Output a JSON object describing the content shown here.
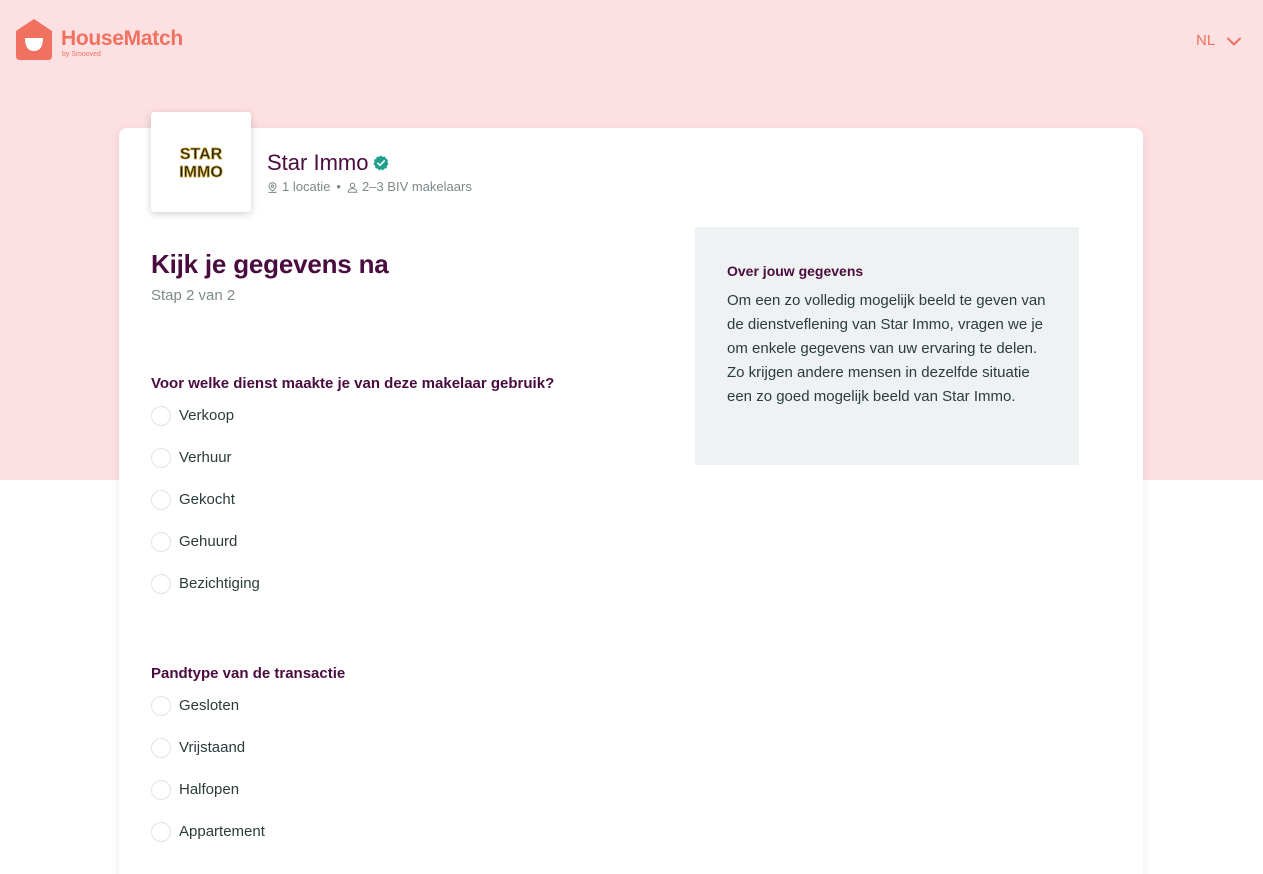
{
  "header": {
    "brand": "HouseMatch",
    "brand_sub": "by Smooved",
    "language": "NL"
  },
  "agency": {
    "name": "Star Immo",
    "logo_text": [
      "STAR",
      "IMMO"
    ],
    "locations": "1 locatie",
    "separator": "•",
    "agents": "2–3 BIV makelaars"
  },
  "form": {
    "title": "Kijk je gegevens na",
    "step": "Stap 2 van 2",
    "questions": [
      {
        "label": "Voor welke dienst maakte je van deze makelaar gebruik?",
        "options": [
          "Verkoop",
          "Verhuur",
          "Gekocht",
          "Gehuurd",
          "Bezichtiging"
        ]
      },
      {
        "label": "Pandtype van de transactie",
        "options": [
          "Gesloten",
          "Vrijstaand",
          "Halfopen",
          "Appartement"
        ]
      }
    ]
  },
  "info": {
    "title": "Over jouw gegevens",
    "text": "Om een zo volledig mogelijk beeld te geven van de dienstveflening van Star Immo, vragen we je om enkele gegevens van uw ervaring te delen. Zo krijgen andere mensen in dezelfde situatie een zo goed mogelijk beeld van Star Immo."
  },
  "colors": {
    "brand": "#f07160",
    "header_bg": "#fde0e1",
    "heading": "#4a0b3f",
    "verified": "#1e9e8c",
    "info_bg": "#eef2f2"
  },
  "icons": {
    "logo": "house-smile-icon",
    "language": "chevron-down-icon",
    "verified": "verified-check-icon",
    "location": "location-pin-icon",
    "agents": "person-icon"
  }
}
